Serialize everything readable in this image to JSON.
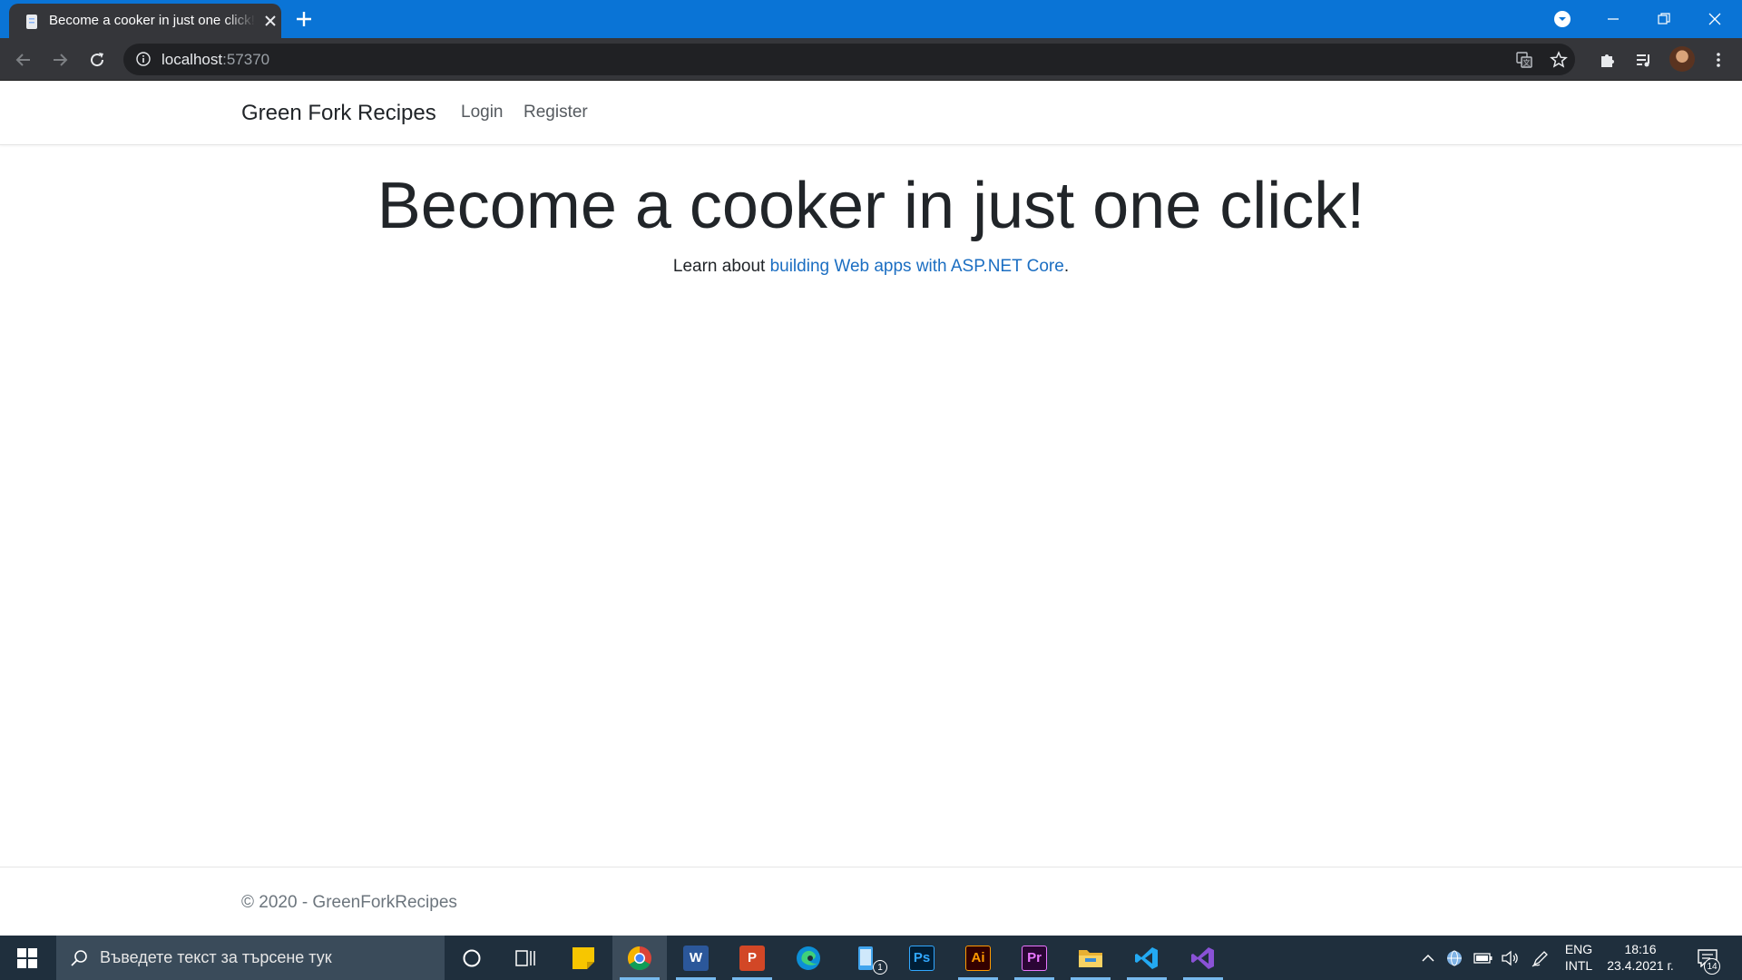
{
  "browser": {
    "tab": {
      "title": "Become a cooker in just one click!"
    },
    "address": {
      "host": "localhost",
      "port": ":57370"
    }
  },
  "page": {
    "navbar": {
      "brand": "Green Fork Recipes",
      "links": [
        "Login",
        "Register"
      ]
    },
    "hero": {
      "heading": "Become a cooker in just one click!",
      "lead_prefix": "Learn about ",
      "lead_link": "building Web apps with ASP.NET Core",
      "lead_suffix": "."
    },
    "footer": {
      "copyright": "© 2020 - GreenForkRecipes"
    }
  },
  "taskbar": {
    "search_placeholder": "Въведете текст за търсене тук",
    "apps": [
      {
        "name": "word",
        "label": "W"
      },
      {
        "name": "powerpoint",
        "label": "P"
      },
      {
        "name": "photoshop",
        "label": "Ps"
      },
      {
        "name": "illustrator",
        "label": "Ai"
      },
      {
        "name": "premiere",
        "label": "Pr"
      }
    ],
    "phone_badge": "1",
    "lang_line1": "ENG",
    "lang_line2": "INTL",
    "time": "18:16",
    "date": "23.4.2021 г.",
    "notifications": "14"
  },
  "colors": {
    "tab_strip": "#0a74d6",
    "toolbar": "#35363a",
    "link": "#1b6ec2",
    "taskbar": "#1f2f3d"
  }
}
